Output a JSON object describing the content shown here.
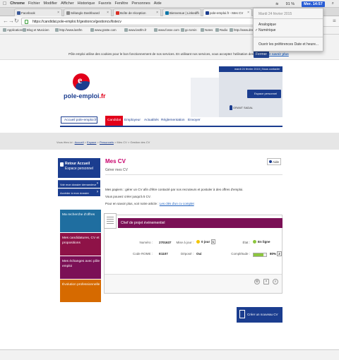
{
  "menubar": {
    "apple": "",
    "app": "Chrome",
    "items": [
      "Fichier",
      "Modifier",
      "Afficher",
      "Historique",
      "Favoris",
      "Fenêtre",
      "Personnes",
      "Aide"
    ],
    "battery": "91 %",
    "clock": "Mer. 14:57"
  },
  "tabs": [
    {
      "label": "Facebook",
      "color": "#3b5998"
    },
    {
      "label": "Sélanglo Dashboard",
      "color": "#8a8a8a"
    },
    {
      "label": "Boîte de réception",
      "color": "#d93025"
    },
    {
      "label": "Bienvenue | LinkedIn",
      "color": "#0e76a8"
    },
    {
      "label": "pole-emploi.fr - Mes CV",
      "color": "#1b3d8f"
    }
  ],
  "nav": {
    "url": "https://candidat.pole-emploi.fr/gestioncv/gestioncv/listecv"
  },
  "bookmarks": [
    "Applications",
    "Blog et Musicien",
    "http://www.lastfm",
    "www.gratte.com",
    "www.lastfm.fr",
    "www.fosse.com",
    "go tomin",
    "Notes",
    "Radio",
    "http://www.dreamfull"
  ],
  "dropdown": {
    "date": "Mardi 24 février 2015",
    "opt1": "Analogique",
    "opt2": "Numérique",
    "check": "✓",
    "prefs": "Ouvrir les préférences Date et heure..."
  },
  "cookie": {
    "text": "Pôle emploi utilise des cookies pour le bon fonctionnement de nos services. En utilisant nos services, vous acceptez l'utilisation des cookies.",
    "link": "En savoir plus",
    "button": "Fermer"
  },
  "header": {
    "logo_name": "pole-emploi",
    "logo_suffix": ".fr",
    "logo_glyph": "e",
    "topbar": "mardi 24 février 2015 | Nous contacter",
    "account_button": "Espace personnel",
    "user": "GRANT SADAL"
  },
  "menu": {
    "home": "Accueil pole-emploi.fr",
    "items": [
      "Candidat",
      "Employeur",
      "Actualités",
      "Réglementation",
      "Envoyer"
    ]
  },
  "breadcrumb": {
    "prefix": "Vous êtes ici :",
    "a": "Accueil",
    "b": "Espace",
    "c": "Personnels",
    "d": "Mes CV",
    "e": "Gestion des CV"
  },
  "sidebar": {
    "head1": "Retour Accueil",
    "head2": "Espace personnel",
    "links": [
      "Voir mon dossier demandeur",
      "Accéder à mon dossier"
    ],
    "squares": [
      {
        "label": "Ma recherche d'offres",
        "color": "#1f6ea0"
      },
      {
        "label": "Mes candidatures, CV et propositions",
        "color": "#8e1247"
      },
      {
        "label": "Mes échanges avec pôle emploi",
        "color": "#7b1056"
      },
      {
        "label": "Évolution professionnelle",
        "color": "#d66a00"
      }
    ]
  },
  "page": {
    "title": "Mes CV",
    "subtitle": "Gérer mes CV",
    "help": "Aide",
    "p1": "Mes papiers : gérer un CV afin d'être contacté par nos recruteurs et postuler à des offres d'emploi.",
    "p2": "Vous pouvez créer jusqu'à 5 CV.",
    "p3": "Pour en savoir plus, voir notre article :",
    "p3_link": "Les clés d'un cv complet"
  },
  "cv": {
    "title": "Chef de projet événementiel",
    "numero_label": "Numéro :",
    "numero": "2701637",
    "rome_label": "Code ROME :",
    "rome": "E1107",
    "maj_label": "Mise à jour :",
    "maj": "0 jour",
    "maj_badge": "1",
    "visible_label": "Déposé :",
    "visible": "Oui",
    "etat_label": "État :",
    "etat": "En ligne",
    "complet_label": "Complétude :",
    "complet": "80%",
    "complet_value": 0.8,
    "complet_badge": "2"
  },
  "create_button": "Créer un nouveau CV"
}
